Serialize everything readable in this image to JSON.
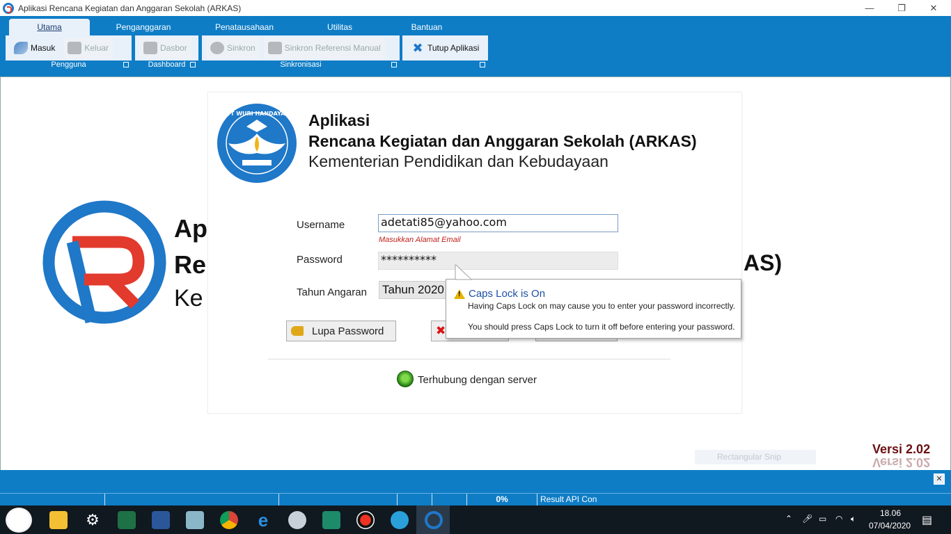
{
  "window": {
    "title": "Aplikasi Rencana Kegiatan dan Anggaran Sekolah (ARKAS)",
    "min": "—",
    "restore": "❐",
    "close": "✕"
  },
  "ribbon": {
    "tabs": [
      {
        "label": "Utama"
      },
      {
        "label": "Penganggaran"
      },
      {
        "label": "Penatausahaan"
      },
      {
        "label": "Utilitas"
      },
      {
        "label": "Bantuan"
      }
    ],
    "groups": {
      "pengguna": {
        "label": "Pengguna",
        "masuk": "Masuk",
        "keluar": "Keluar"
      },
      "dashboard": {
        "label": "Dashboard",
        "dasbor": "Dasbor"
      },
      "sinkronisasi": {
        "label": "Sinkronisasi",
        "sinkron": "Sinkron",
        "sinkron_ref": "Sinkron Referensi Manual"
      },
      "tutup": {
        "label": "",
        "tutup_aplikasi": "Tutup Aplikasi"
      }
    }
  },
  "background": {
    "line1": "Ap",
    "line2": "Re",
    "line2_end": "AS)",
    "line3": "Ke"
  },
  "login": {
    "heading1": "Aplikasi",
    "heading2": "Rencana Kegiatan dan Anggaran Sekolah (ARKAS)",
    "heading3": "Kementerian Pendidikan dan Kebudayaan",
    "emblem_text": "TUT WURI HANDAYANI",
    "username_label": "Username",
    "username_value": "adetati85@yahoo.com",
    "username_hint": "Masukkan Alamat Email",
    "password_label": "Password",
    "password_value": "**********",
    "tahun_label": "Tahun Angaran",
    "tahun_value": "Tahun 2020",
    "lupa_password": "Lupa Password",
    "connection_status": "Terhubung dengan server"
  },
  "tooltip": {
    "title": "Caps Lock is On",
    "line1": "Having Caps Lock on may cause you to enter your password incorrectly.",
    "line2": "You should press Caps Lock to turn it off before entering your password."
  },
  "version": "Versi 2.02",
  "snip_ghost": "Rectangular Snip",
  "statusbar": {
    "progress": "0%",
    "progress_value": 0,
    "result": "Result API Con"
  },
  "taskbar": {
    "time": "18.06",
    "date": "07/04/2020"
  },
  "colors": {
    "ribbon_blue": "#0e7dc6",
    "hint_red": "#c0201a",
    "version_maroon": "#6b0f12",
    "led_green": "#3fb61e",
    "logo_blue": "#1f78c8",
    "logo_red": "#e23a2c"
  }
}
